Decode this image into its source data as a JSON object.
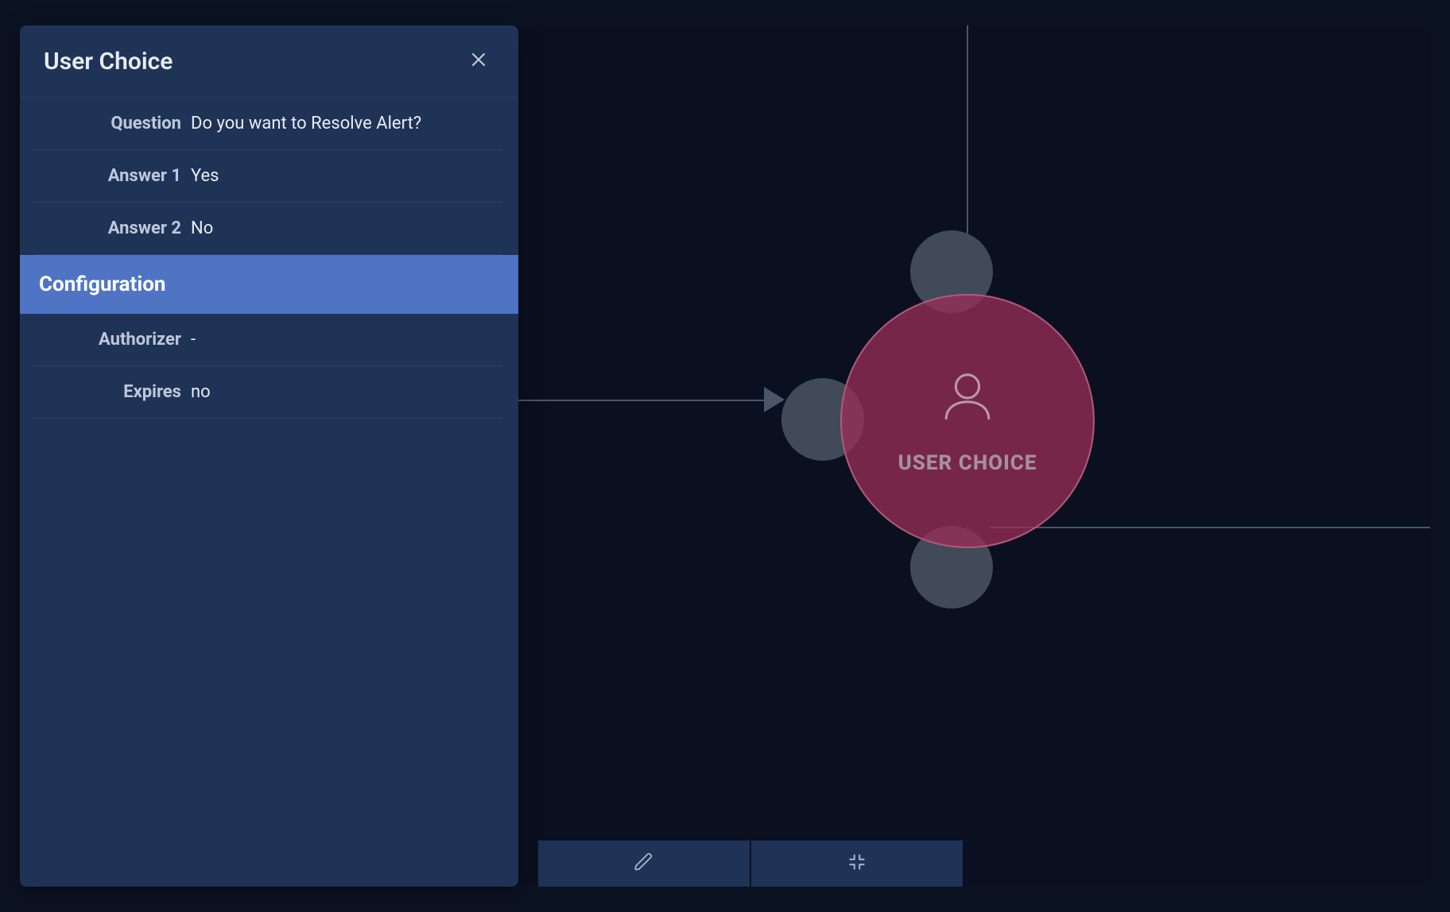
{
  "panel": {
    "title": "User Choice",
    "question_label": "Question",
    "question_value": "Do you want to Resolve Alert?",
    "answers": [
      {
        "label": "Answer 1",
        "value": "Yes"
      },
      {
        "label": "Answer 2",
        "value": "No"
      }
    ],
    "section_header": "Configuration",
    "config": {
      "authorizer_label": "Authorizer",
      "authorizer_value": "-",
      "expires_label": "Expires",
      "expires_value": "no"
    }
  },
  "canvas": {
    "node_label": "USER CHOICE"
  },
  "icons": {
    "close": "close-icon",
    "user": "user-icon",
    "edit": "pencil-icon",
    "collapse": "collapse-icon"
  },
  "colors": {
    "bg": "#0b1222",
    "panel_bg": "#1f3357",
    "section_bg": "#4f74c4",
    "node_fill": "rgba(155,45,86,0.75)",
    "node_border": "#b25a7b",
    "edge": "#4a5568",
    "port": "#414a59"
  }
}
